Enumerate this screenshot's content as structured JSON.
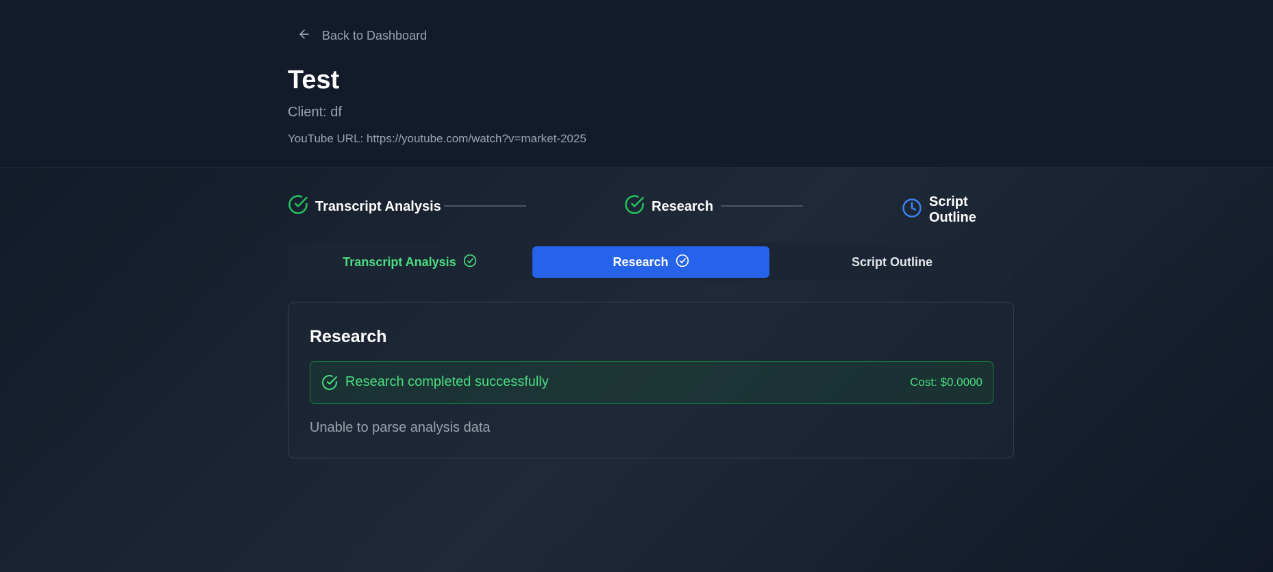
{
  "nav": {
    "back_label": "Back to Dashboard",
    "back_icon": "arrow-left-icon"
  },
  "project": {
    "title": "Test",
    "client": "Client: df",
    "youtube_url": "YouTube URL: https://youtube.com/watch?v=market-2025"
  },
  "stepper": {
    "steps": [
      {
        "label": "Transcript Analysis",
        "status": "completed",
        "icon": "check-circle-icon",
        "color": "#22c55e"
      },
      {
        "label": "Research",
        "status": "completed",
        "icon": "check-circle-icon",
        "color": "#22c55e"
      },
      {
        "label": "Script Outline",
        "status": "pending",
        "icon": "clock-icon",
        "color": "#3b82f6"
      }
    ]
  },
  "tabs": [
    {
      "label": "Transcript Analysis",
      "state": "completed",
      "icon": "check-circle-icon"
    },
    {
      "label": "Research",
      "state": "active",
      "icon": "check-circle-icon"
    },
    {
      "label": "Script Outline",
      "state": "default"
    }
  ],
  "research": {
    "title": "Research",
    "status_message": "Research completed successfully",
    "cost": "Cost: $0.0000",
    "body_message": "Unable to parse analysis data"
  },
  "colors": {
    "accent": "#2563eb",
    "success": "#4ade80",
    "background": "#111827"
  }
}
